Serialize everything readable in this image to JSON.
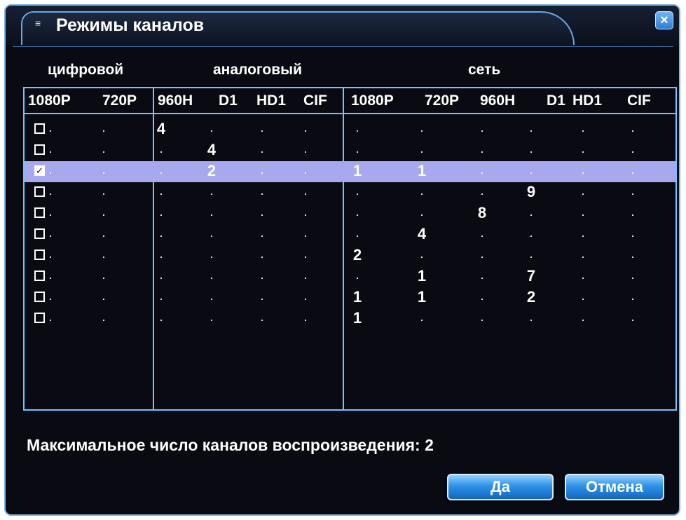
{
  "dialog": {
    "title": "Режимы каналов",
    "close_label": "×",
    "accent_color": "#6fc5ff",
    "selection_color": "#a7a8ee"
  },
  "groups": {
    "digital": "цифровой",
    "analog": "аналоговый",
    "network": "сеть"
  },
  "columns": [
    "1080P",
    "720P",
    "960H",
    "D1",
    "HD1",
    "CIF",
    "1080P",
    "720P",
    "960H",
    "D1",
    "HD1",
    "CIF"
  ],
  "rows": [
    {
      "checked": false,
      "selected": false,
      "cells": [
        "",
        "",
        "4",
        "",
        "",
        "",
        "",
        "",
        "",
        "",
        "",
        ""
      ]
    },
    {
      "checked": false,
      "selected": false,
      "cells": [
        "",
        "",
        "",
        "4",
        "",
        "",
        "",
        "",
        "",
        "",
        "",
        ""
      ]
    },
    {
      "checked": true,
      "selected": true,
      "cells": [
        "",
        "",
        "",
        "2",
        "",
        "",
        "1",
        "1",
        "",
        "",
        "",
        ""
      ]
    },
    {
      "checked": false,
      "selected": false,
      "cells": [
        "",
        "",
        "",
        "",
        "",
        "",
        "",
        "",
        "",
        "9",
        "",
        ""
      ]
    },
    {
      "checked": false,
      "selected": false,
      "cells": [
        "",
        "",
        "",
        "",
        "",
        "",
        "",
        "",
        "8",
        "",
        "",
        ""
      ]
    },
    {
      "checked": false,
      "selected": false,
      "cells": [
        "",
        "",
        "",
        "",
        "",
        "",
        "",
        "4",
        "",
        "",
        "",
        ""
      ]
    },
    {
      "checked": false,
      "selected": false,
      "cells": [
        "",
        "",
        "",
        "",
        "",
        "",
        "2",
        "",
        "",
        "",
        "",
        ""
      ]
    },
    {
      "checked": false,
      "selected": false,
      "cells": [
        "",
        "",
        "",
        "",
        "",
        "",
        "",
        "1",
        "",
        "7",
        "",
        ""
      ]
    },
    {
      "checked": false,
      "selected": false,
      "cells": [
        "",
        "",
        "",
        "",
        "",
        "",
        "1",
        "1",
        "",
        "2",
        "",
        ""
      ]
    },
    {
      "checked": false,
      "selected": false,
      "cells": [
        "",
        "",
        "",
        "",
        "",
        "",
        "1",
        "",
        "",
        "",
        "",
        ""
      ]
    }
  ],
  "footer": {
    "max_channels_text": "Максимальное число каналов воспроизведения: 2"
  },
  "buttons": {
    "ok_label": "Да",
    "cancel_label": "Отмена"
  }
}
